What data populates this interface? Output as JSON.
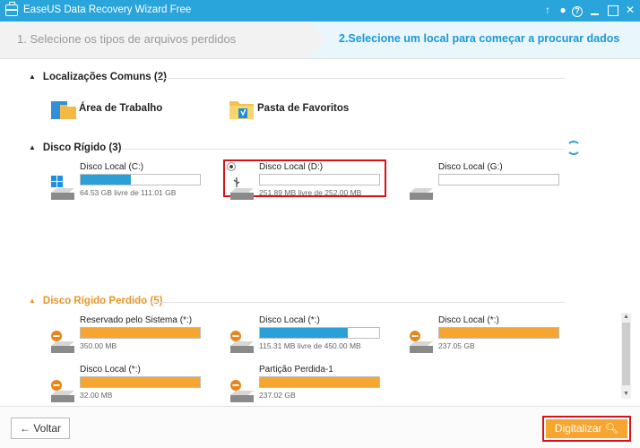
{
  "window": {
    "title": "EaseUS Data Recovery Wizard Free"
  },
  "steps": {
    "step1": "1. Selecione os tipos de arquivos perdidos",
    "step2": "2.Selecione um local para começar a procurar dados"
  },
  "common": {
    "header": "Localizações Comuns (2)",
    "items": [
      {
        "label": "Área de Trabalho",
        "icon": "desktop-icon"
      },
      {
        "label": "Pasta de Favoritos",
        "icon": "favorites-folder-icon"
      }
    ]
  },
  "disks": {
    "header": "Disco Rígido (3)",
    "items": [
      {
        "name": "Disco Local (C:)",
        "size": "64.53 GB livre de 111.01 GB",
        "used_fraction": 0.42,
        "color": "#2aa0d8",
        "icon": "windows-drive-icon"
      },
      {
        "name": "Disco Local (D:)",
        "size": "251.89 MB livre de 252.00 MB",
        "used_fraction": 0.0,
        "color": "#2aa0d8",
        "icon": "usb-drive-icon",
        "selected": true
      },
      {
        "name": "Disco Local (G:)",
        "size": "",
        "used_fraction": 0.0,
        "color": "#2aa0d8",
        "icon": "hard-drive-icon"
      }
    ]
  },
  "lost": {
    "header": "Disco Rígido Perdido (5)",
    "items": [
      {
        "name": "Reservado pelo Sistema (*:)",
        "size": "350.00 MB",
        "used_fraction": 1.0,
        "color": "#f6a630"
      },
      {
        "name": "Disco Local (*:)",
        "size": "115.31 MB livre de 450.00 MB",
        "used_fraction": 0.74,
        "color": "#2aa0d8"
      },
      {
        "name": "Disco Local (*:)",
        "size": "237.05 GB",
        "used_fraction": 1.0,
        "color": "#f6a630"
      },
      {
        "name": "Disco Local (*:)",
        "size": "32.00 MB",
        "used_fraction": 1.0,
        "color": "#f6a630"
      },
      {
        "name": "Partição Perdida-1",
        "size": "237.02 GB",
        "used_fraction": 1.0,
        "color": "#f6a630"
      }
    ]
  },
  "footer": {
    "back_label": "Voltar",
    "scan_label": "Digitalizar"
  },
  "colors": {
    "accent": "#29a5dc",
    "orange": "#f6a630",
    "highlight": "#d8111b"
  }
}
